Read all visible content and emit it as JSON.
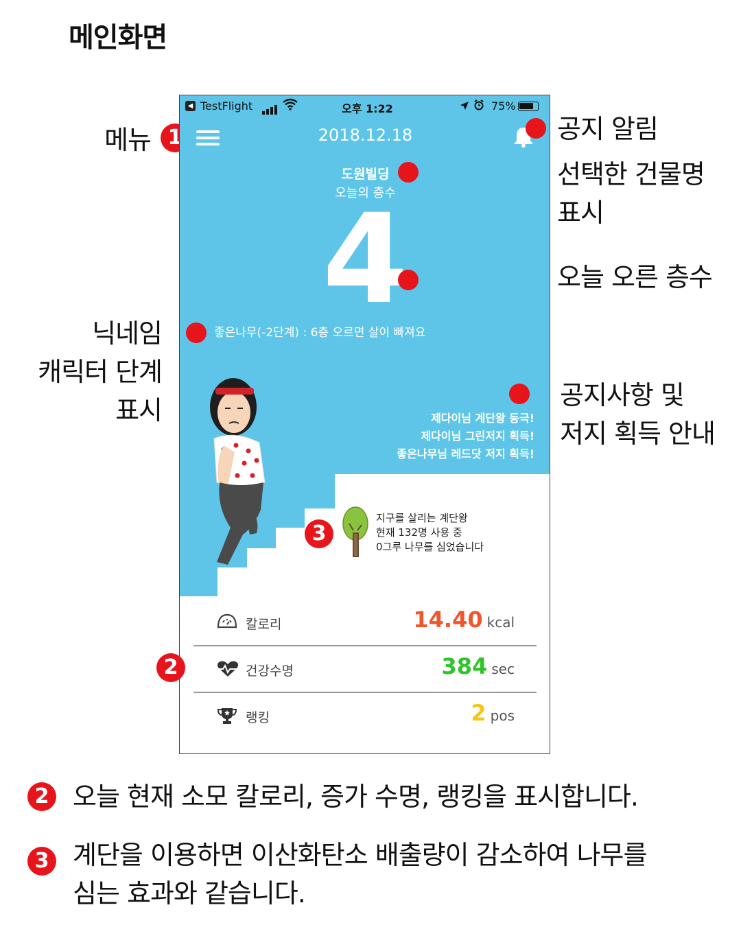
{
  "page_title": "메인화면",
  "annotations": {
    "menu": "메뉴",
    "notice_alarm": "공지 알림",
    "building_name": [
      "선택한 건물명",
      "표시"
    ],
    "floors_today": "오늘 오른 층수",
    "nickname": [
      "닉네임",
      "캐릭터 단계",
      "표시"
    ],
    "notice_badge": [
      "공지사항 및",
      "저지 획득 안내"
    ]
  },
  "badges": {
    "one": "1",
    "two": "2",
    "three": "3"
  },
  "status_bar": {
    "app": "TestFlight",
    "time": "오후 1:22",
    "battery": "75%"
  },
  "header": {
    "date": "2018.12.18"
  },
  "building": {
    "name": "도원빌딩",
    "floor_label": "오늘의 층수",
    "floor_count": "4"
  },
  "level_text": "좋은나무(-2단계) : 6층 오르면 살이 빠져요",
  "notices": [
    "제다이님 계단왕 등극!",
    "제다이님 그린저지 획득!",
    "좋은나무님 레드닷 저지 획득!"
  ],
  "tree_info": [
    "지구를 살리는 계단왕",
    "현재 132명 사용 중",
    "0그루 나무를 심었습니다"
  ],
  "stats": [
    {
      "label": "칼로리",
      "value": "14.40",
      "unit": "kcal",
      "icon": "scale-icon",
      "color": "#f0552c"
    },
    {
      "label": "건강수명",
      "value": "384",
      "unit": "sec",
      "icon": "heartbeat-icon",
      "color": "#2fc42a"
    },
    {
      "label": "랭킹",
      "value": "2",
      "unit": "pos",
      "icon": "trophy-icon",
      "color": "#f5c518"
    }
  ],
  "footnotes": {
    "two": "오늘 현재 소모 칼로리, 증가 수명, 랭킹을 표시합니다.",
    "three": [
      "계단을 이용하면 이산화탄소 배출량이 감소하여 나무를",
      "심는 효과와 같습니다."
    ]
  },
  "colors": {
    "sky": "#5ec5e8",
    "accent_red": "#e8141c"
  }
}
